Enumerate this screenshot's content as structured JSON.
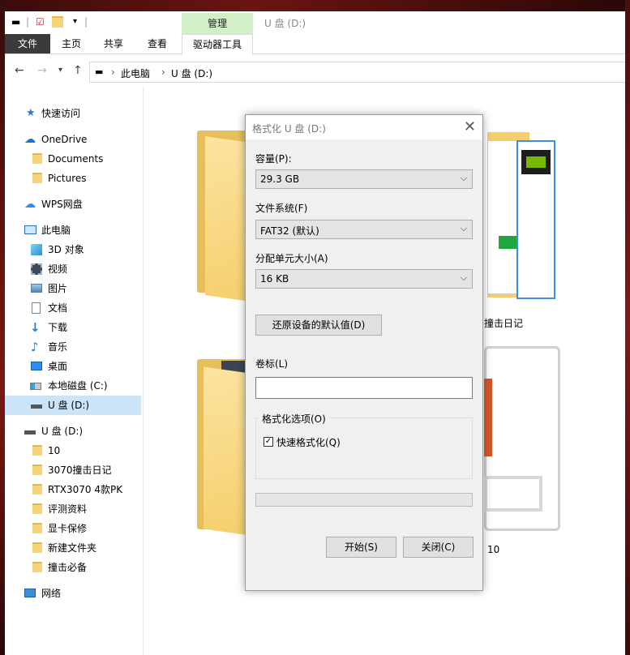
{
  "window": {
    "title": "U 盘 (D:)",
    "context_tab": "管理"
  },
  "ribbon": {
    "tabs": [
      "文件",
      "主页",
      "共享",
      "查看",
      "驱动器工具"
    ]
  },
  "address": {
    "crumbs": [
      "此电脑",
      "U 盘 (D:)"
    ]
  },
  "sidebar": {
    "quick_access": "快速访问",
    "onedrive": "OneDrive",
    "documents": "Documents",
    "pictures": "Pictures",
    "wps": "WPS网盘",
    "this_pc": "此电脑",
    "objects3d": "3D 对象",
    "videos": "视频",
    "images": "图片",
    "docs_cn": "文档",
    "downloads": "下载",
    "music": "音乐",
    "desktop": "桌面",
    "local_disk": "本地磁盘 (C:)",
    "usb": "U 盘 (D:)",
    "usb2": "U 盘 (D:)",
    "f10": "10",
    "f3070": "3070撞击日记",
    "frtx": "RTX3070 4款PK",
    "freview": "评测资料",
    "fwarranty": "显卡保修",
    "fnew": "新建文件夹",
    "fmust": "撞击必备",
    "network": "网络"
  },
  "main": {
    "item_label_1": "撞击日记",
    "item_label_2": "10"
  },
  "dialog": {
    "title": "格式化 U 盘 (D:)",
    "capacity_label": "容量(P):",
    "capacity_value": "29.3 GB",
    "fs_label": "文件系统(F)",
    "fs_value": "FAT32 (默认)",
    "alloc_label": "分配单元大小(A)",
    "alloc_value": "16 KB",
    "restore_button": "还原设备的默认值(D)",
    "volume_label": "卷标(L)",
    "volume_value": "",
    "options_title": "格式化选项(O)",
    "quick_format_label": "快速格式化(Q)",
    "quick_format_checked": true,
    "progress": 0,
    "start_button": "开始(S)",
    "close_button": "关闭(C)"
  }
}
